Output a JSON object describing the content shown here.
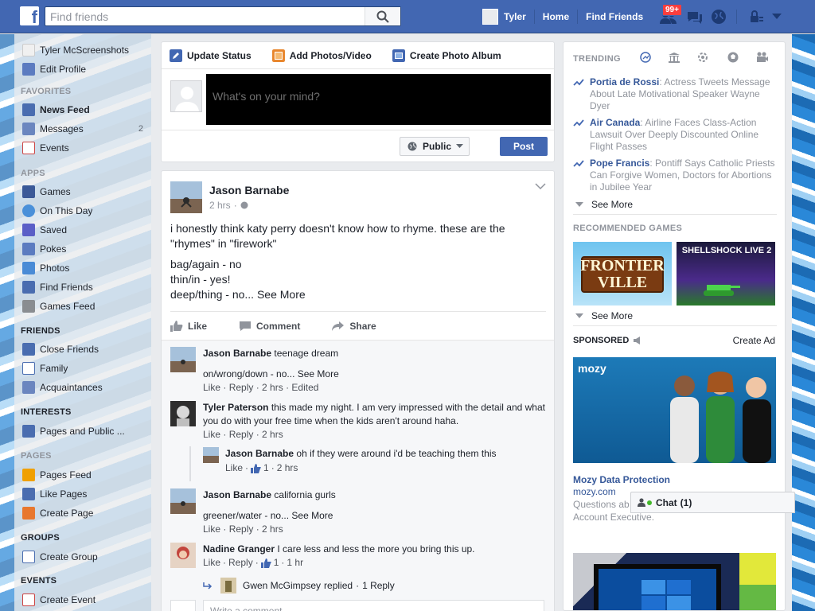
{
  "topbar": {
    "logo": "f",
    "search_placeholder": "Find friends",
    "user_name": "Tyler",
    "home": "Home",
    "find_friends": "Find Friends",
    "friend_requests_badge": "99+"
  },
  "sidebar": {
    "profile_name": "Tyler McScreenshots",
    "edit_profile": "Edit Profile",
    "favorites_head": "FAVORITES",
    "favorites": [
      {
        "label": "News Feed",
        "count": ""
      },
      {
        "label": "Messages",
        "count": "2"
      },
      {
        "label": "Events",
        "count": ""
      }
    ],
    "apps_head": "APPS",
    "apps": [
      "Games",
      "On This Day",
      "Saved",
      "Pokes",
      "Photos",
      "Find Friends",
      "Games Feed"
    ],
    "friends_head": "FRIENDS",
    "friends": [
      "Close Friends",
      "Family",
      "Acquaintances"
    ],
    "interests_head": "INTERESTS",
    "interests": [
      "Pages and Public ..."
    ],
    "pages_head": "PAGES",
    "pages": [
      "Pages Feed",
      "Like Pages",
      "Create Page"
    ],
    "groups_head": "GROUPS",
    "groups": [
      "Create Group"
    ],
    "events_head": "EVENTS",
    "events": [
      "Create Event"
    ]
  },
  "composer": {
    "tab_status": "Update Status",
    "tab_photos": "Add Photos/Video",
    "tab_album": "Create Photo Album",
    "placeholder": "What's on your mind?",
    "audience": "Public",
    "post_label": "Post"
  },
  "post": {
    "author": "Jason Barnabe",
    "time": "2 hrs",
    "line1": "i honestly think katy perry doesn't know how to rhyme. these are the \"rhymes\" in \"firework\"",
    "line2": "bag/again - no",
    "line3": "thin/in - yes!",
    "line4": "deep/thing - no...",
    "see_more": "See More",
    "like": "Like",
    "comment": "Comment",
    "share": "Share"
  },
  "comments": [
    {
      "name": "Jason Barnabe",
      "text": "teenage dream",
      "text2": "on/wrong/down - no...",
      "see_more": "See More",
      "like": "Like",
      "reply": "Reply",
      "time": "2 hrs",
      "extra": "Edited"
    },
    {
      "name": "Tyler Paterson",
      "text": "this made my night. I am very impressed with the detail and what you do with your free time when the kids aren't around haha.",
      "like": "Like",
      "reply": "Reply",
      "time": "2 hrs"
    },
    {
      "name": "Jason Barnabe",
      "text": "oh if they were around i'd be teaching them this",
      "like": "Like",
      "likes": "1",
      "time": "2 hrs"
    },
    {
      "name": "Jason Barnabe",
      "text": "california gurls",
      "text2": "greener/water - no...",
      "see_more": "See More",
      "like": "Like",
      "reply": "Reply",
      "time": "2 hrs"
    },
    {
      "name": "Nadine Granger",
      "text": "I care less and less the more you bring this up.",
      "like": "Like",
      "reply": "Reply",
      "likes": "1",
      "time": "1 hr"
    }
  ],
  "reply_summary": {
    "name": "Gwen McGimpsey",
    "text": "replied",
    "count": "1 Reply"
  },
  "write_comment_placeholder": "Write a comment...",
  "right": {
    "trending_head": "TRENDING",
    "trends": [
      {
        "topic": "Portia de Rossi",
        "desc": "Actress Tweets Message About Late Motivational Speaker Wayne Dyer"
      },
      {
        "topic": "Air Canada",
        "desc": "Airline Faces Class-Action Lawsuit Over Deeply Discounted Online Flight Passes"
      },
      {
        "topic": "Pope Francis",
        "desc": "Pontiff Says Catholic Priests Can Forgive Women, Doctors for Abortions in Jubilee Year"
      }
    ],
    "see_more": "See More",
    "games_head": "RECOMMENDED GAMES",
    "game1_line1": "FRONTIER",
    "game1_line2": "VILLE",
    "game2": "SHELLSHOCK LIVE 2",
    "sponsored_head": "SPONSORED",
    "create_ad": "Create Ad",
    "ad_brand": "mozy",
    "ad_title": "Mozy Data Protection",
    "ad_domain": "mozy.com",
    "ad_desc1": "Questions ab",
    "ad_desc2": "Account Executive."
  },
  "chat": {
    "label": "Chat",
    "count": "(1)"
  },
  "colors": {
    "fb_blue": "#4267b2",
    "link": "#365899",
    "badge": "#fa3e3e",
    "online": "#42b72a"
  }
}
